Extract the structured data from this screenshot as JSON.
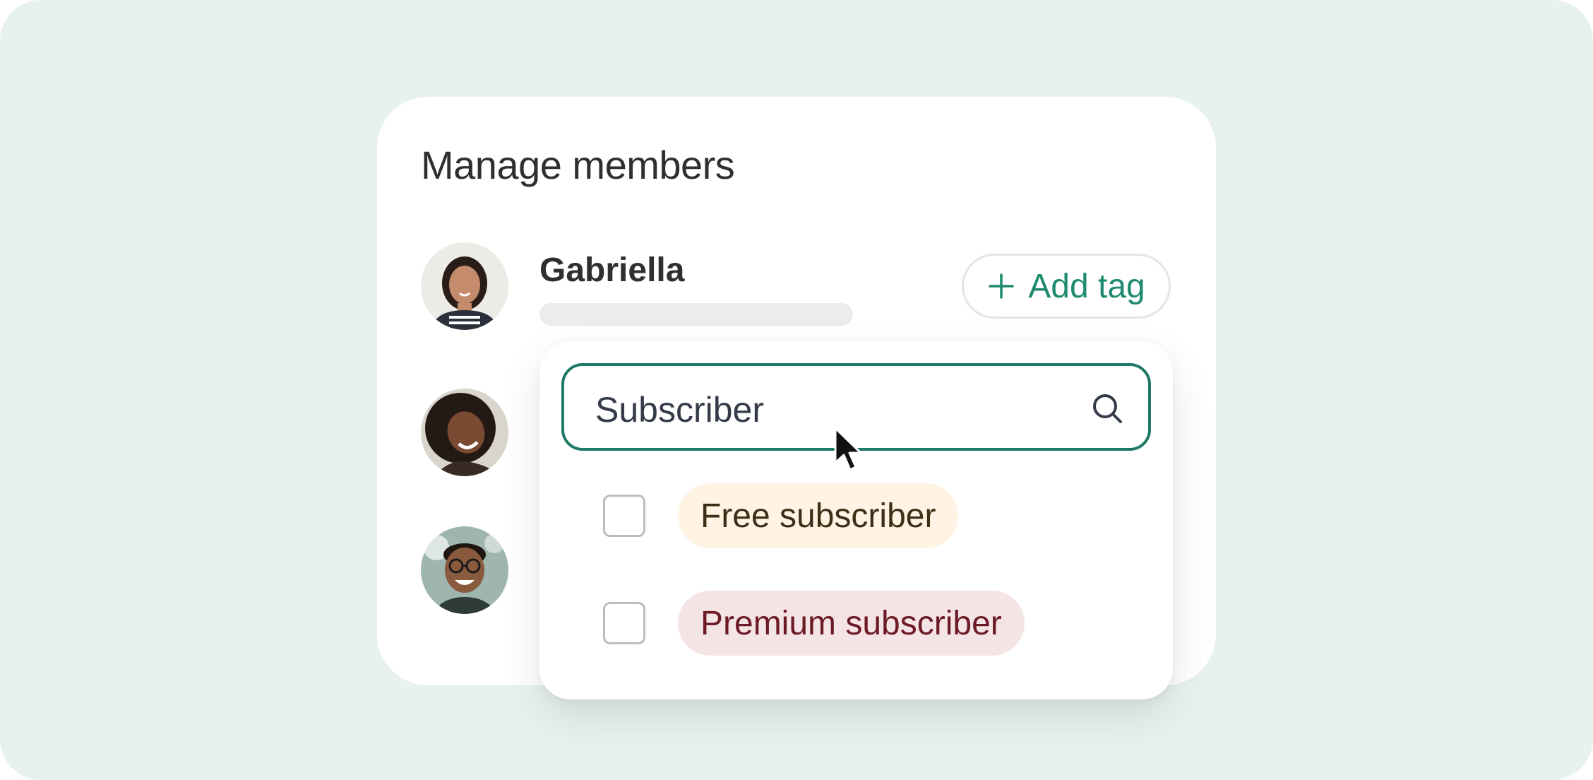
{
  "card": {
    "title": "Manage members"
  },
  "members": [
    {
      "name": "Gabriella",
      "avatar_icon": "member-avatar-photo"
    },
    {
      "name": "",
      "avatar_icon": "member-avatar-photo"
    },
    {
      "name": "",
      "avatar_icon": "member-avatar-photo"
    }
  ],
  "add_tag": {
    "label": "Add tag",
    "icon": "plus-icon"
  },
  "tag_dropdown": {
    "search_value": "Subscriber",
    "search_icon": "search-icon",
    "options": [
      {
        "label": "Free subscriber",
        "checked": false,
        "bg": "#fff3e4",
        "fg": "#3d2e16"
      },
      {
        "label": "Premium subscriber",
        "checked": false,
        "bg": "#f5e4e6",
        "fg": "#6b1a26"
      }
    ]
  },
  "colors": {
    "background": "#e7f1ef",
    "accent": "#1e8a6e",
    "input_border": "#1e7a66"
  }
}
